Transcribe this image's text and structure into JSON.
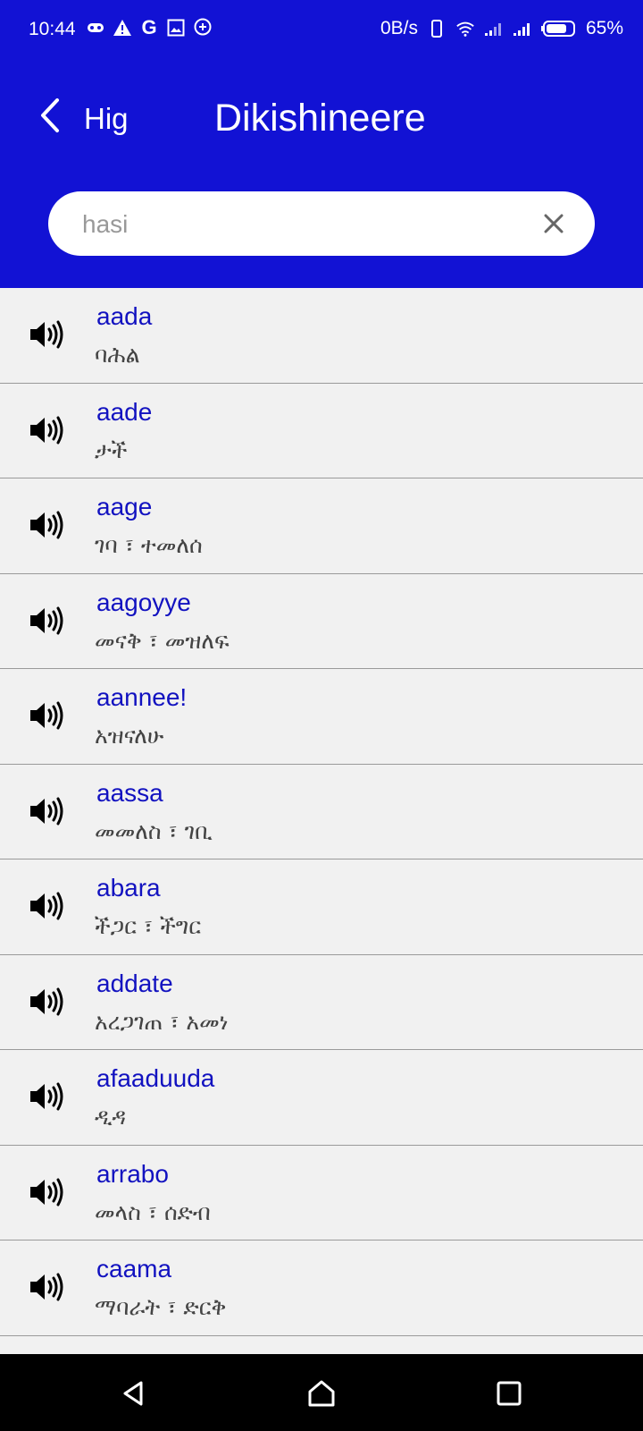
{
  "status_bar": {
    "time": "10:44",
    "network_speed": "0B/s",
    "battery": "65%",
    "icons": [
      "game-icon",
      "alert-icon",
      "google-icon",
      "image-icon",
      "plus-bubble-icon",
      "phone-icon",
      "wifi-icon",
      "signal-icon",
      "signal-icon",
      "battery-icon"
    ]
  },
  "header": {
    "back_label": "Hig",
    "title": "Dikishineere"
  },
  "search": {
    "placeholder": "hasi",
    "value": ""
  },
  "entries": [
    {
      "word": "aada",
      "definition": "ባሕል"
    },
    {
      "word": "aade",
      "definition": "ታች"
    },
    {
      "word": "aage",
      "definition": "ገባ ፣ ተመለሰ"
    },
    {
      "word": "aagoyye",
      "definition": "መናቅ ፣ መዝለፍ"
    },
    {
      "word": "aannee!",
      "definition": "አዝናለሁ"
    },
    {
      "word": "aassa",
      "definition": "መመለስ ፣ ገቢ"
    },
    {
      "word": "abara",
      "definition": "ችጋር ፣ ችግር"
    },
    {
      "word": "addate",
      "definition": "አረጋገጠ ፣ አመነ"
    },
    {
      "word": "afaaduuda",
      "definition": "ዲዳ"
    },
    {
      "word": "arrabo",
      "definition": "መላስ ፣ ሰድብ"
    },
    {
      "word": "caama",
      "definition": "ማባራት ፣ ድርቅ"
    }
  ],
  "colors": {
    "header": "#1212d4",
    "word": "#1212c0",
    "list_bg": "#f1f1f1"
  }
}
